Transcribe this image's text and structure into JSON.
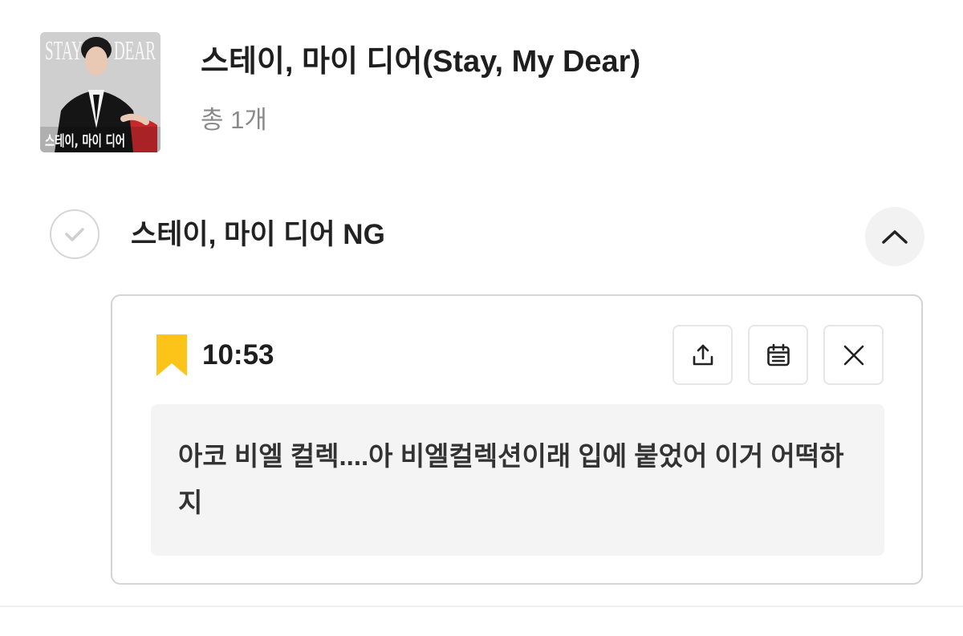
{
  "album": {
    "title": "스테이, 마이 디어(Stay, My Dear)",
    "count": "총 1개",
    "cover": {
      "label_top": "STAY MY DEAR",
      "label_bottom": "스테이, 마이 디어"
    }
  },
  "episode": {
    "title": "스테이, 마이 디어 NG",
    "checked": false
  },
  "memo": {
    "timestamp": "10:53",
    "text": "아코 비엘 컬렉....아 비엘컬렉션이래 입에 붙었어 이거 어떡하지",
    "bookmark_color": "#fcc419"
  },
  "icons": {
    "check": "check-icon",
    "collapse": "chevron-up-icon",
    "share": "share-icon",
    "calendar": "calendar-icon",
    "close": "close-icon",
    "bookmark": "bookmark-icon"
  }
}
